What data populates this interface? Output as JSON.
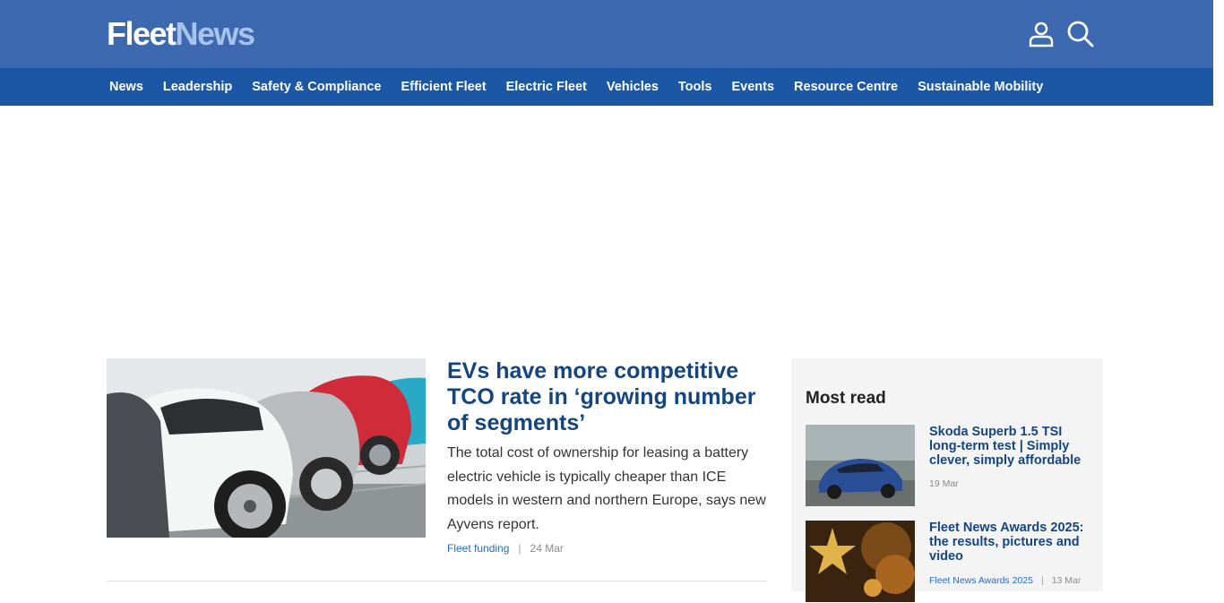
{
  "header": {
    "logo": {
      "part1": "Fleet",
      "part2": "News"
    },
    "icons": {
      "account": "user-icon",
      "search": "search-icon"
    },
    "colors": {
      "topbar": "#3d69b1",
      "navbar": "#1c57a6",
      "headline": "#15457f",
      "link": "#2a6bc4"
    }
  },
  "nav": {
    "items": [
      {
        "label": "News"
      },
      {
        "label": "Leadership"
      },
      {
        "label": "Safety & Compliance"
      },
      {
        "label": "Efficient Fleet"
      },
      {
        "label": "Electric Fleet"
      },
      {
        "label": "Vehicles"
      },
      {
        "label": "Tools"
      },
      {
        "label": "Events"
      },
      {
        "label": "Resource Centre"
      },
      {
        "label": "Sustainable Mobility"
      }
    ]
  },
  "lead": {
    "title": "EVs have more competitive TCO rate in ‘growing number of segments’",
    "summary": "The total cost of ownership for leasing a battery electric vehicle is typically cheaper than ICE models in western and northern Europe, says new Ayvens report.",
    "category": "Fleet funding",
    "date": "24 Mar"
  },
  "most_read": {
    "heading": "Most read",
    "items": [
      {
        "title": "Skoda Superb 1.5 TSI long-term test | Simply clever, simply affordable",
        "category": "",
        "date": "19 Mar"
      },
      {
        "title": "Fleet News Awards 2025: the results, pictures and video",
        "category": "Fleet News Awards 2025",
        "date": "13 Mar"
      }
    ]
  }
}
